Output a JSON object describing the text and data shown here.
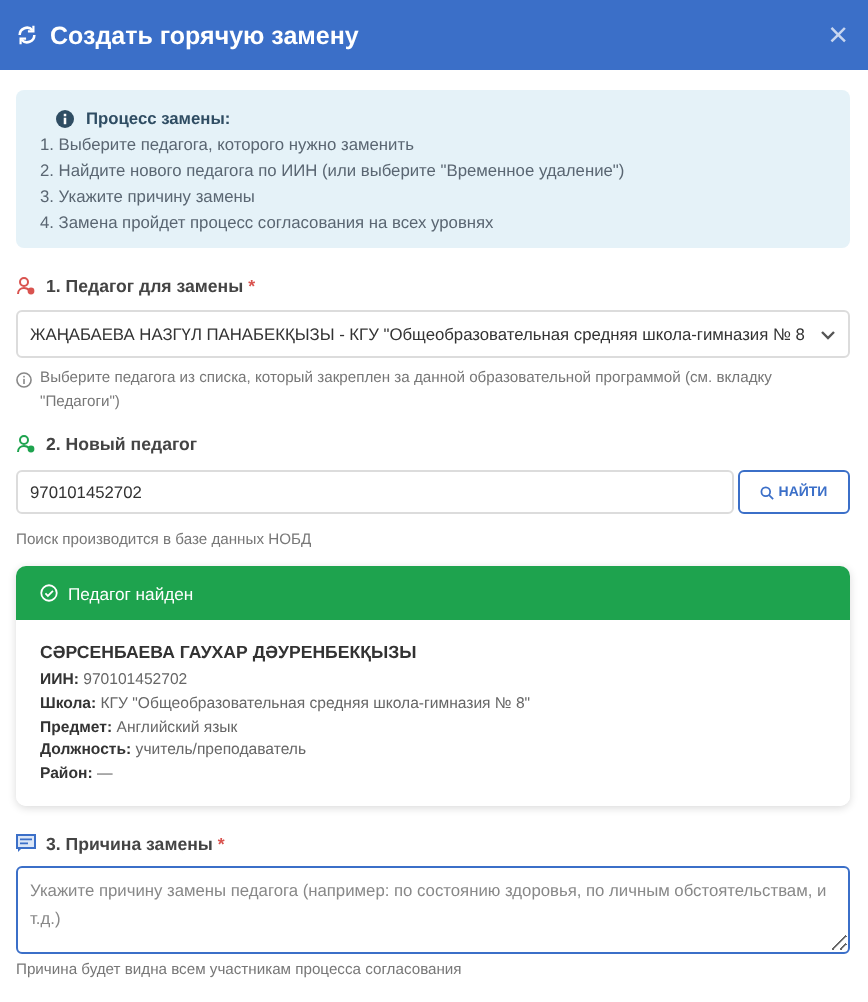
{
  "dialog": {
    "title": "Создать горячую замену",
    "close": "×"
  },
  "info": {
    "title": "Процесс замены:",
    "steps": [
      "1. Выберите педагога, которого нужно заменить",
      "2. Найдите нового педагога по ИИН (или выберите \"Временное удаление\")",
      "3. Укажите причину замены",
      "4. Замена пройдет процесс согласования на всех уровнях"
    ]
  },
  "teacher_select": {
    "label": "1. Педагог для замены",
    "required_mark": "*",
    "value": "ЖАҢАБАЕВА НАЗГҮЛ ПАНАБЕКҚЫЗЫ - КГУ \"Общеобразовательная средняя школа-гимназия № 8",
    "hint": "Выберите педагога из списка, который закреплен за данной образовательной программой (см. вкладку \"Педагоги\")"
  },
  "new_teacher": {
    "label": "2. Новый педагог",
    "value": "970101452702",
    "button": "НАЙТИ",
    "note": "Поиск производится в базе данных НОБД"
  },
  "result": {
    "status": "Педагог найден",
    "name": "СӘРСЕНБАЕВА ГАУХАР ДӘУРЕНБЕКҚЫЗЫ",
    "details": [
      "**ИИН:** 970101452702",
      "**Школа:** КГУ \"Общеобразовательная средняя школа-гимназия № 8\"",
      "**Предмет:** Английский язык",
      "**Должность:** учитель/преподаватель",
      "**Район:** —"
    ]
  },
  "reason": {
    "label": "3. Причина замены",
    "required_mark": "*",
    "placeholder": "Укажите причину замены педагога (например: по состоянию здоровья, по личным обстоятельствам, и т.д.)",
    "note": "Причина будет видна всем участникам процесса согласования"
  }
}
